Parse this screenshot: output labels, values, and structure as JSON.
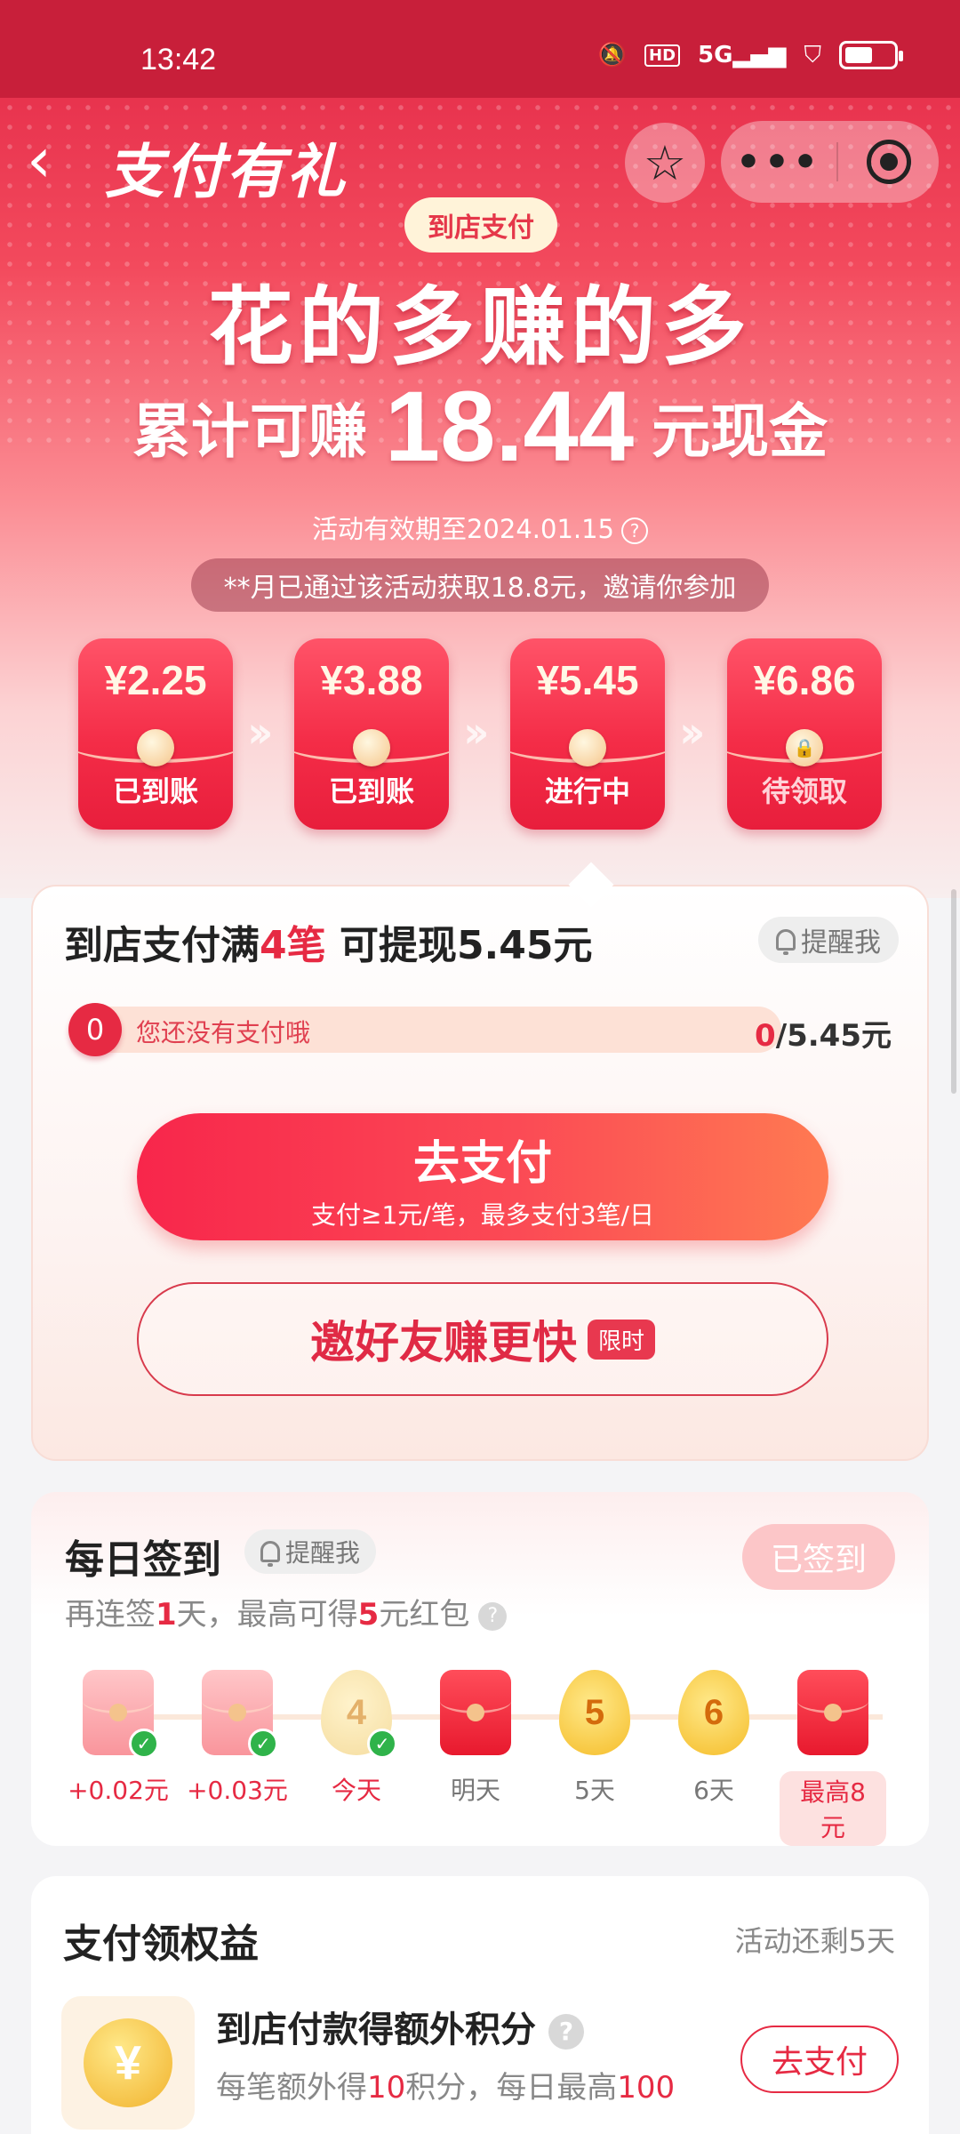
{
  "status_bar": {
    "time": "13:42",
    "network": "5G",
    "hd": "HD"
  },
  "nav": {
    "title": "支付有礼"
  },
  "hero": {
    "tag": "到店支付",
    "headline": "花的多赚的多",
    "subline_prefix": "累计可赚",
    "subline_amount": "18.44",
    "subline_suffix": "元现金",
    "validity": "活动有效期至2024.01.15",
    "notice": "**月已通过该活动获取18.8元，邀请你参加"
  },
  "steps": [
    {
      "amount": "¥2.25",
      "status": "已到账",
      "locked": false
    },
    {
      "amount": "¥3.88",
      "status": "已到账",
      "locked": false
    },
    {
      "amount": "¥5.45",
      "status": "进行中",
      "locked": false
    },
    {
      "amount": "¥6.86",
      "status": "待领取",
      "locked": true
    }
  ],
  "task": {
    "title_pre": "到店支付满",
    "title_count": "4笔",
    "title_post": " 可提现5.45元",
    "remind": "提醒我",
    "progress_badge": "0",
    "progress_msg": "您还没有支付哦",
    "progress_current": "0",
    "progress_total": "/5.45元",
    "progress_fraction": 0,
    "pay_label": "去支付",
    "pay_sub": "支付≥1元/笔，最多支付3笔/日",
    "invite_label": "邀好友赚更快",
    "invite_tag": "限时"
  },
  "checkin": {
    "title": "每日签到",
    "remind": "提醒我",
    "signed_label": "已签到",
    "sub_pre": "再连签",
    "sub_days": "1",
    "sub_mid": "天，最高可得",
    "sub_amount": "5",
    "sub_post": "元红包",
    "days": [
      {
        "kind": "envelope-pale",
        "checked": true,
        "label": "+0.02元",
        "style": "red"
      },
      {
        "kind": "envelope-pale",
        "checked": true,
        "label": "+0.03元",
        "style": "red"
      },
      {
        "kind": "drop-pale",
        "num": "4",
        "checked": true,
        "label": "今天",
        "style": "red"
      },
      {
        "kind": "envelope",
        "checked": false,
        "label": "明天",
        "style": "gray"
      },
      {
        "kind": "drop",
        "num": "5",
        "checked": false,
        "label": "5天",
        "style": "gray"
      },
      {
        "kind": "drop",
        "num": "6",
        "checked": false,
        "label": "6天",
        "style": "gray"
      },
      {
        "kind": "envelope",
        "checked": false,
        "label": "最高8元",
        "style": "pill"
      }
    ]
  },
  "benefits": {
    "title": "支付领权益",
    "remaining": "活动还剩5天",
    "item_name": "到店付款得额外积分",
    "item_desc_pre": "每笔额外得",
    "item_desc_num1": "10",
    "item_desc_mid": "积分，每日最高",
    "item_desc_num2": "100",
    "item_button": "去支付"
  },
  "colors": {
    "accent": "#e62a43",
    "hero_top": "#d82341",
    "button_end": "#ff7a52"
  },
  "icons": [
    "back-icon",
    "star-icon",
    "more-icon",
    "target-icon",
    "bell-icon",
    "help-icon",
    "check-icon",
    "coin-icon"
  ]
}
